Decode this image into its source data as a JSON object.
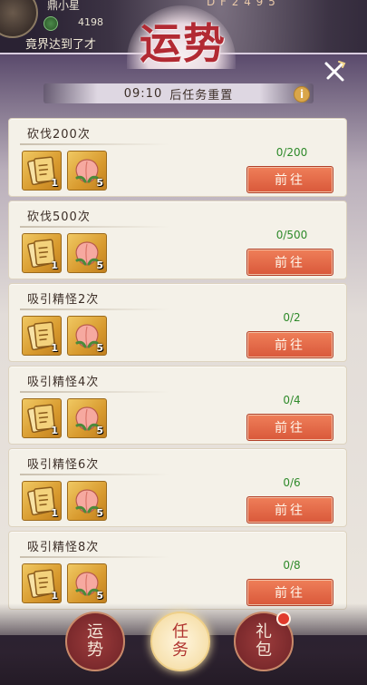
{
  "header": {
    "player_name": "鼎小星",
    "coin_value": "4198",
    "scroll_text": "竟界达到了才",
    "top_right_text": "D F 2 4 9 5",
    "title": "运势"
  },
  "panel": {
    "reset_time": "09:10",
    "reset_text": "后任务重置",
    "info_label": "i",
    "close_label": "close"
  },
  "tasks": [
    {
      "name": "砍伐200次",
      "progress": "0/200",
      "button": "前往",
      "rewards": [
        {
          "icon": "ticket-icon",
          "count": "1"
        },
        {
          "icon": "peach-icon",
          "count": "5"
        }
      ]
    },
    {
      "name": "砍伐500次",
      "progress": "0/500",
      "button": "前往",
      "rewards": [
        {
          "icon": "ticket-icon",
          "count": "1"
        },
        {
          "icon": "peach-icon",
          "count": "5"
        }
      ]
    },
    {
      "name": "吸引精怪2次",
      "progress": "0/2",
      "button": "前往",
      "rewards": [
        {
          "icon": "ticket-icon",
          "count": "1"
        },
        {
          "icon": "peach-icon",
          "count": "5"
        }
      ]
    },
    {
      "name": "吸引精怪4次",
      "progress": "0/4",
      "button": "前往",
      "rewards": [
        {
          "icon": "ticket-icon",
          "count": "1"
        },
        {
          "icon": "peach-icon",
          "count": "5"
        }
      ]
    },
    {
      "name": "吸引精怪6次",
      "progress": "0/6",
      "button": "前往",
      "rewards": [
        {
          "icon": "ticket-icon",
          "count": "1"
        },
        {
          "icon": "peach-icon",
          "count": "5"
        }
      ]
    },
    {
      "name": "吸引精怪8次",
      "progress": "0/8",
      "button": "前往",
      "rewards": [
        {
          "icon": "ticket-icon",
          "count": "1"
        },
        {
          "icon": "peach-icon",
          "count": "5"
        }
      ]
    }
  ],
  "nav": {
    "fortune": "运势",
    "task": "任务",
    "gift": "礼包"
  },
  "colors": {
    "accent_button": "#d9583a",
    "progress_text": "#2e8a2a",
    "title_red": "#b22a33"
  }
}
